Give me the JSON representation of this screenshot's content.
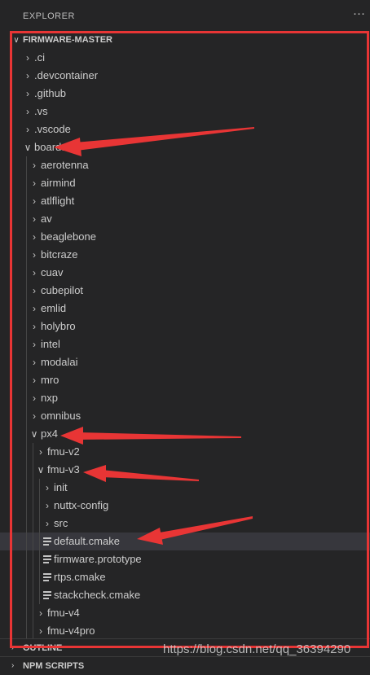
{
  "explorer": {
    "header": "EXPLORER",
    "more_label": "···",
    "root_label": "FIRMWARE-MASTER",
    "tree": [
      {
        "label": ".ci",
        "type": "folder",
        "expanded": false,
        "depth": 0
      },
      {
        "label": ".devcontainer",
        "type": "folder",
        "expanded": false,
        "depth": 0
      },
      {
        "label": ".github",
        "type": "folder",
        "expanded": false,
        "depth": 0
      },
      {
        "label": ".vs",
        "type": "folder",
        "expanded": false,
        "depth": 0
      },
      {
        "label": ".vscode",
        "type": "folder",
        "expanded": false,
        "depth": 0
      },
      {
        "label": "boards",
        "type": "folder",
        "expanded": true,
        "depth": 0
      },
      {
        "label": "aerotenna",
        "type": "folder",
        "expanded": false,
        "depth": 1
      },
      {
        "label": "airmind",
        "type": "folder",
        "expanded": false,
        "depth": 1
      },
      {
        "label": "atlflight",
        "type": "folder",
        "expanded": false,
        "depth": 1
      },
      {
        "label": "av",
        "type": "folder",
        "expanded": false,
        "depth": 1
      },
      {
        "label": "beaglebone",
        "type": "folder",
        "expanded": false,
        "depth": 1
      },
      {
        "label": "bitcraze",
        "type": "folder",
        "expanded": false,
        "depth": 1
      },
      {
        "label": "cuav",
        "type": "folder",
        "expanded": false,
        "depth": 1
      },
      {
        "label": "cubepilot",
        "type": "folder",
        "expanded": false,
        "depth": 1
      },
      {
        "label": "emlid",
        "type": "folder",
        "expanded": false,
        "depth": 1
      },
      {
        "label": "holybro",
        "type": "folder",
        "expanded": false,
        "depth": 1
      },
      {
        "label": "intel",
        "type": "folder",
        "expanded": false,
        "depth": 1
      },
      {
        "label": "modalai",
        "type": "folder",
        "expanded": false,
        "depth": 1
      },
      {
        "label": "mro",
        "type": "folder",
        "expanded": false,
        "depth": 1
      },
      {
        "label": "nxp",
        "type": "folder",
        "expanded": false,
        "depth": 1
      },
      {
        "label": "omnibus",
        "type": "folder",
        "expanded": false,
        "depth": 1
      },
      {
        "label": "px4",
        "type": "folder",
        "expanded": true,
        "depth": 1
      },
      {
        "label": "fmu-v2",
        "type": "folder",
        "expanded": false,
        "depth": 2
      },
      {
        "label": "fmu-v3",
        "type": "folder",
        "expanded": true,
        "depth": 2
      },
      {
        "label": "init",
        "type": "folder",
        "expanded": false,
        "depth": 3
      },
      {
        "label": "nuttx-config",
        "type": "folder",
        "expanded": false,
        "depth": 3
      },
      {
        "label": "src",
        "type": "folder",
        "expanded": false,
        "depth": 3
      },
      {
        "label": "default.cmake",
        "type": "file",
        "selected": true,
        "depth": 3
      },
      {
        "label": "firmware.prototype",
        "type": "file",
        "depth": 3
      },
      {
        "label": "rtps.cmake",
        "type": "file",
        "depth": 3
      },
      {
        "label": "stackcheck.cmake",
        "type": "file",
        "depth": 3
      },
      {
        "label": "fmu-v4",
        "type": "folder",
        "expanded": false,
        "depth": 2
      },
      {
        "label": "fmu-v4pro",
        "type": "folder",
        "expanded": false,
        "depth": 2
      }
    ]
  },
  "sections": {
    "outline": "OUTLINE",
    "npm_scripts": "NPM SCRIPTS"
  },
  "watermark": "https://blog.csdn.net/qq_36394290",
  "colors": {
    "sidebar_bg": "#252526",
    "text": "#cccccc",
    "selection_bg": "#37373d",
    "annotation_red": "#e83535"
  }
}
